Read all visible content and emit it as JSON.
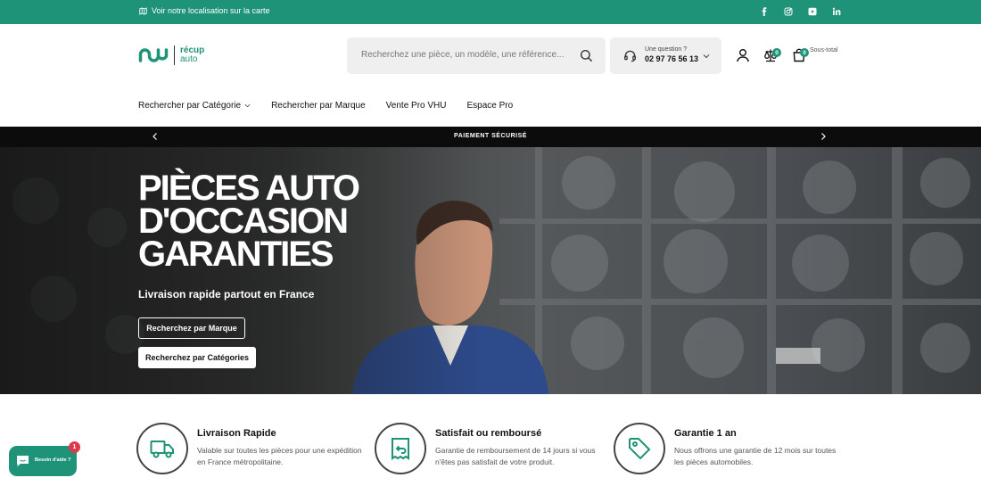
{
  "topbar": {
    "location_text": "Voir notre localisation sur la carte",
    "social": [
      "facebook-icon",
      "instagram-icon",
      "youtube-icon",
      "linkedin-icon"
    ]
  },
  "brand": {
    "line1": "récup",
    "line2": "auto",
    "color": "#1e9377"
  },
  "search": {
    "placeholder": "Recherchez une pièce, un modèle, une référence..."
  },
  "contact": {
    "label": "Une question ?",
    "phone": "02 97 76 56 13"
  },
  "header": {
    "compare_count": "0",
    "cart_count": "0",
    "subtotal_label": "Sous-total"
  },
  "nav": [
    {
      "label": "Rechercher par Catégorie"
    },
    {
      "label": "Rechercher par Marque"
    },
    {
      "label": "Vente Pro VHU"
    },
    {
      "label": "Espace Pro"
    }
  ],
  "announcement": {
    "text": "PAIEMENT SÉCURISÉ"
  },
  "hero": {
    "headline_1": "PIÈCES AUTO",
    "headline_2": "D'OCCASION",
    "headline_3": "GARANTIES",
    "subtitle": "Livraison rapide partout en France",
    "button_brand": "Recherchez par Marque",
    "button_category": "Recherchez par Catégories"
  },
  "features": [
    {
      "title": "Livraison Rapide",
      "desc": "Valable sur toutes les pièces pour une expédition en France métropolitaine.",
      "icon": "truck-icon"
    },
    {
      "title": "Satisfait ou remboursé",
      "desc": "Garantie de remboursement de 14 jours si vous n'êtes pas satisfait de votre produit.",
      "icon": "return-icon"
    },
    {
      "title": "Garantie 1 an",
      "desc": "Nous offrons une garantie de 12 mois sur toutes les pièces automobiles.",
      "icon": "tag-icon"
    }
  ],
  "chat": {
    "label": "Besoin d'aide ?",
    "badge": "1"
  }
}
